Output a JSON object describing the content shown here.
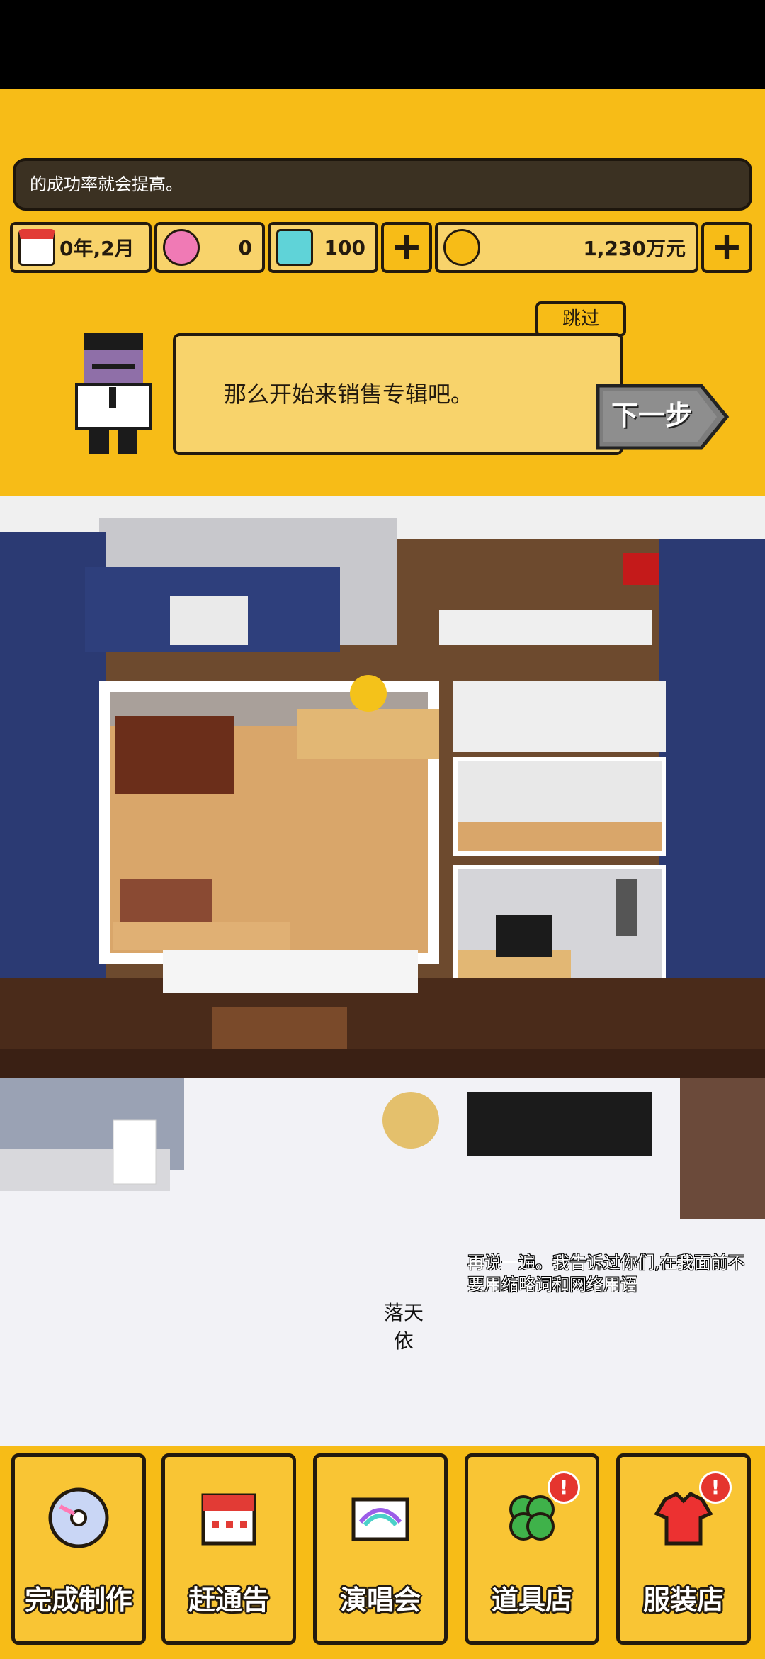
{
  "top": {
    "tip_text": "的成功率就会提高。",
    "date": "0年,2月",
    "hearts": "0",
    "diamonds": "100",
    "money": "1,230万元",
    "skip_label": "跳过",
    "dialog_text": "那么开始来销售专辑吧。",
    "next_label": "下一步"
  },
  "scene": {
    "character_name": "落天依",
    "speech": "再说一遍。我告诉过你们,在我面前不要用缩略词和网络用语"
  },
  "bottom_nav": [
    {
      "label": "完成制作",
      "icon": "disc-icon"
    },
    {
      "label": "赶通告",
      "icon": "calendar-icon"
    },
    {
      "label": "演唱会",
      "icon": "stage-icon",
      "badge": ""
    },
    {
      "label": "道具店",
      "icon": "clover-icon",
      "badge": "!"
    },
    {
      "label": "服装店",
      "icon": "shirt-icon",
      "badge": "!"
    }
  ]
}
